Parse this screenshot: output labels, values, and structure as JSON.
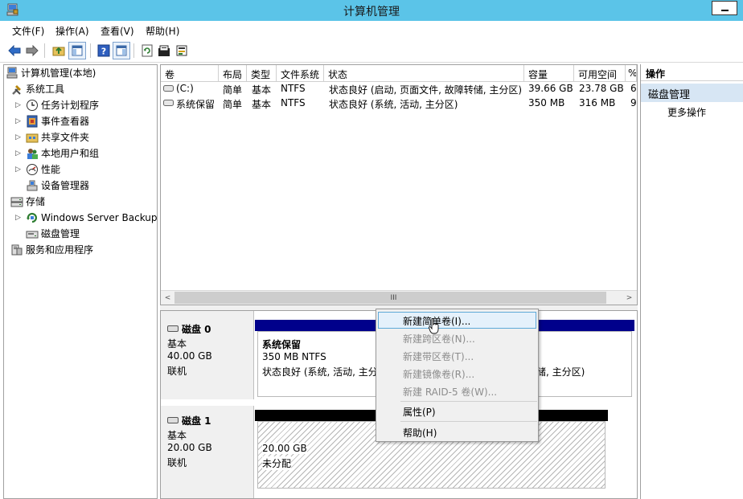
{
  "window": {
    "title": "计算机管理"
  },
  "menu": [
    "文件(F)",
    "操作(A)",
    "查看(V)",
    "帮助(H)"
  ],
  "toolbar": {
    "buttons": [
      "back-icon",
      "forward-icon",
      "up-folder-icon",
      "show-hide-tree-icon",
      "help-icon",
      "show-hide-action-pane-icon",
      "refresh-icon",
      "properties-icon",
      "export-icon"
    ]
  },
  "tree": [
    {
      "label": "计算机管理(本地)",
      "icon": "computer-management-icon"
    },
    {
      "label": "系统工具",
      "icon": "system-tools-icon"
    },
    {
      "label": "任务计划程序",
      "icon": "task-scheduler-icon"
    },
    {
      "label": "事件查看器",
      "icon": "event-viewer-icon"
    },
    {
      "label": "共享文件夹",
      "icon": "shared-folders-icon"
    },
    {
      "label": "本地用户和组",
      "icon": "users-groups-icon"
    },
    {
      "label": "性能",
      "icon": "performance-icon"
    },
    {
      "label": "设备管理器",
      "icon": "device-manager-icon"
    },
    {
      "label": "存储",
      "icon": "storage-icon"
    },
    {
      "label": "Windows Server Backup",
      "icon": "backup-icon"
    },
    {
      "label": "磁盘管理",
      "icon": "disk-management-icon"
    },
    {
      "label": "服务和应用程序",
      "icon": "services-apps-icon"
    }
  ],
  "volumes": {
    "columns": [
      "卷",
      "布局",
      "类型",
      "文件系统",
      "状态",
      "容量",
      "可用空间",
      "%"
    ],
    "rows": [
      {
        "volume": "(C:)",
        "layout": "简单",
        "type": "基本",
        "fs": "NTFS",
        "status": "状态良好 (启动, 页面文件, 故障转储, 主分区)",
        "capacity": "39.66 GB",
        "free": "23.78 GB",
        "pct": "6"
      },
      {
        "volume": "系统保留",
        "layout": "简单",
        "type": "基本",
        "fs": "NTFS",
        "status": "状态良好 (系统, 活动, 主分区)",
        "capacity": "350 MB",
        "free": "316 MB",
        "pct": "9"
      }
    ],
    "scroll_grip": "III"
  },
  "disks": [
    {
      "name": "磁盘 0",
      "type": "基本",
      "size": "40.00 GB",
      "state": "联机",
      "partition": {
        "name": "系统保留",
        "size": "350 MB NTFS",
        "status": "状态良好 (系统, 活动, 主分",
        "tail": "储, 主分区)"
      }
    },
    {
      "name": "磁盘 1",
      "type": "基本",
      "size": "20.00 GB",
      "state": "联机",
      "partition": {
        "size": "20.00 GB",
        "status": "未分配"
      }
    }
  ],
  "context_menu": {
    "items": [
      {
        "label": "新建简单卷(I)...",
        "state": "highlighted"
      },
      {
        "label": "新建跨区卷(N)...",
        "state": "disabled"
      },
      {
        "label": "新建带区卷(T)...",
        "state": "disabled"
      },
      {
        "label": "新建镜像卷(R)...",
        "state": "disabled"
      },
      {
        "label": "新建 RAID-5 卷(W)...",
        "state": "disabled"
      },
      {
        "label": "属性(P)",
        "state": "enabled"
      },
      {
        "label": "帮助(H)",
        "state": "enabled"
      }
    ]
  },
  "actions": {
    "header": "操作",
    "section": "磁盘管理",
    "more": "更多操作"
  },
  "colors": {
    "titlebar": "#5bc4e8",
    "disk0_bar": "#00008b",
    "disk1_bar": "#000000",
    "menu_highlight": "#e5f1fb",
    "action_section": "#d7e6f4"
  }
}
